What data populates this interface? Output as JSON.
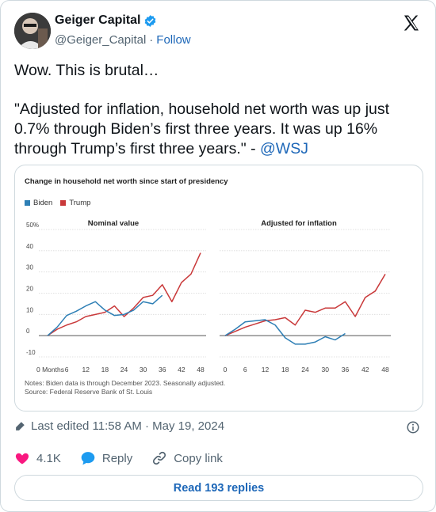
{
  "author": {
    "display_name": "Geiger Capital",
    "handle": "@Geiger_Capital",
    "separator": "·",
    "follow_label": "Follow"
  },
  "tweet": {
    "line1": "Wow. This is brutal…",
    "quote": "\"Adjusted for inflation, household net worth was up just 0.7% through Biden’s first three years. It was up 16% through Trump’s first three years.\" - ",
    "mention": "@WSJ"
  },
  "meta": {
    "edited": "Last edited 11:58 AM · May 19, 2024"
  },
  "actions": {
    "likes": "4.1K",
    "reply_label": "Reply",
    "copy_label": "Copy link"
  },
  "read_replies_label": "Read 193 replies",
  "colors": {
    "biden": "#2e7fb5",
    "trump": "#c9393a",
    "link": "#1d67b8",
    "like": "#f91880"
  },
  "chart_data": {
    "type": "line",
    "title": "Change in household net worth since start of presidency",
    "legend": [
      "Biden",
      "Trump"
    ],
    "notes": [
      "Notes: Biden data is through December 2023. Seasonally adjusted.",
      "Source: Federal Reserve Bank of St. Louis"
    ],
    "x_ticks": [
      "0 Months",
      "6",
      "12",
      "18",
      "24",
      "30",
      "36",
      "42",
      "48"
    ],
    "x_ticks_plain": [
      "0",
      "6",
      "12",
      "18",
      "24",
      "30",
      "36",
      "42",
      "48"
    ],
    "y_ticks": [
      "50%",
      "40",
      "30",
      "20",
      "10",
      "0",
      "-10"
    ],
    "panels": [
      {
        "title": "Nominal value",
        "xlim": [
          0,
          48
        ],
        "ylim": [
          -10,
          50
        ],
        "series": [
          {
            "name": "Biden",
            "x": [
              0,
              3,
              6,
              9,
              12,
              15,
              18,
              21,
              24,
              27,
              30,
              33,
              36
            ],
            "y": [
              0,
              4,
              9.5,
              11.5,
              14,
              16,
              12,
              9.5,
              10,
              12,
              16,
              15,
              19
            ]
          },
          {
            "name": "Trump",
            "x": [
              0,
              3,
              6,
              9,
              12,
              15,
              18,
              21,
              24,
              27,
              30,
              33,
              36,
              39,
              42,
              45,
              48
            ],
            "y": [
              0,
              3,
              5,
              6.5,
              9,
              10,
              11,
              14,
              9,
              13,
              18,
              19,
              24,
              16,
              25,
              29,
              39
            ]
          }
        ]
      },
      {
        "title": "Adjusted for inflation",
        "xlim": [
          0,
          48
        ],
        "ylim": [
          -10,
          50
        ],
        "series": [
          {
            "name": "Biden",
            "x": [
              0,
              3,
              6,
              9,
              12,
              15,
              18,
              21,
              24,
              27,
              30,
              33,
              36
            ],
            "y": [
              0,
              3,
              6.5,
              7,
              7.5,
              5,
              -1,
              -4,
              -4,
              -3,
              -0.5,
              -2,
              1
            ]
          },
          {
            "name": "Trump",
            "x": [
              0,
              3,
              6,
              9,
              12,
              15,
              18,
              21,
              24,
              27,
              30,
              33,
              36,
              39,
              42,
              45,
              48
            ],
            "y": [
              0,
              2,
              4,
              5.5,
              7,
              7.5,
              8.5,
              5,
              12,
              11,
              13,
              13,
              16,
              9,
              18,
              21,
              29
            ]
          }
        ]
      }
    ]
  }
}
